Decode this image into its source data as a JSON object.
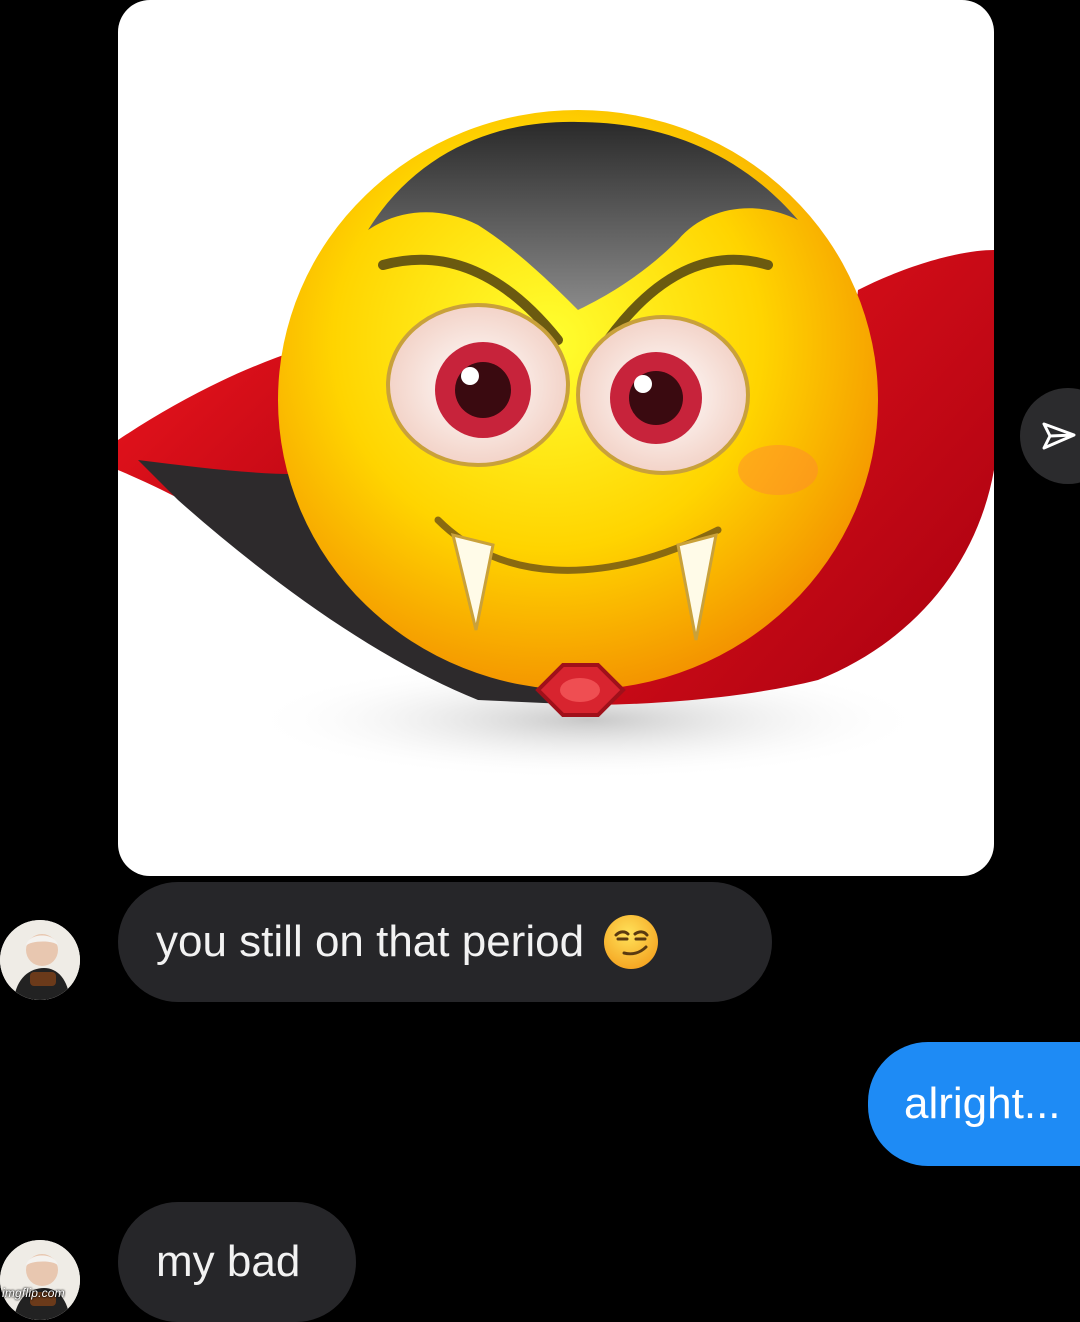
{
  "thread": {
    "image_message": {
      "icon": "vampire-emoji-image"
    },
    "share_icon": "paper-plane-icon",
    "messages": [
      {
        "sender": "them",
        "text": "you still on that period",
        "emoji": "smirking-face-emoji"
      },
      {
        "sender": "me",
        "text": "alright..."
      },
      {
        "sender": "them",
        "text": "my bad"
      }
    ]
  },
  "watermark": "imgflip.com",
  "colors": {
    "background": "#000000",
    "incoming_bubble": "#262629",
    "outgoing_bubble": "#1e8bf5",
    "incoming_text": "#f2f2f2",
    "outgoing_text": "#ffffff"
  }
}
